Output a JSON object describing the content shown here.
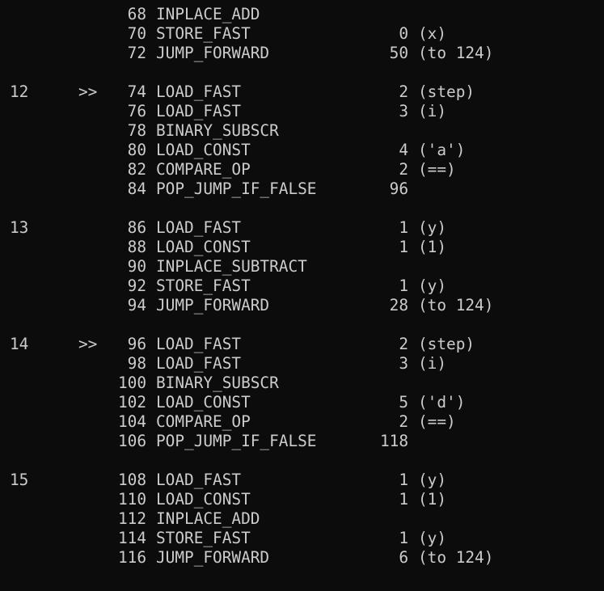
{
  "terminal": {
    "background": "#0c0c0c",
    "foreground": "#cccccc",
    "lines": [
      {
        "lineno": "",
        "jump": "",
        "offset": "68",
        "opname": "INPLACE_ADD",
        "arg": "",
        "argrepr": ""
      },
      {
        "lineno": "",
        "jump": "",
        "offset": "70",
        "opname": "STORE_FAST",
        "arg": "0",
        "argrepr": "(x)"
      },
      {
        "lineno": "",
        "jump": "",
        "offset": "72",
        "opname": "JUMP_FORWARD",
        "arg": "50",
        "argrepr": "(to 124)"
      },
      {
        "blank": true
      },
      {
        "lineno": "12",
        "jump": ">>",
        "offset": "74",
        "opname": "LOAD_FAST",
        "arg": "2",
        "argrepr": "(step)"
      },
      {
        "lineno": "",
        "jump": "",
        "offset": "76",
        "opname": "LOAD_FAST",
        "arg": "3",
        "argrepr": "(i)"
      },
      {
        "lineno": "",
        "jump": "",
        "offset": "78",
        "opname": "BINARY_SUBSCR",
        "arg": "",
        "argrepr": ""
      },
      {
        "lineno": "",
        "jump": "",
        "offset": "80",
        "opname": "LOAD_CONST",
        "arg": "4",
        "argrepr": "('a')"
      },
      {
        "lineno": "",
        "jump": "",
        "offset": "82",
        "opname": "COMPARE_OP",
        "arg": "2",
        "argrepr": "(==)"
      },
      {
        "lineno": "",
        "jump": "",
        "offset": "84",
        "opname": "POP_JUMP_IF_FALSE",
        "arg": "96",
        "argrepr": ""
      },
      {
        "blank": true
      },
      {
        "lineno": "13",
        "jump": "",
        "offset": "86",
        "opname": "LOAD_FAST",
        "arg": "1",
        "argrepr": "(y)"
      },
      {
        "lineno": "",
        "jump": "",
        "offset": "88",
        "opname": "LOAD_CONST",
        "arg": "1",
        "argrepr": "(1)"
      },
      {
        "lineno": "",
        "jump": "",
        "offset": "90",
        "opname": "INPLACE_SUBTRACT",
        "arg": "",
        "argrepr": ""
      },
      {
        "lineno": "",
        "jump": "",
        "offset": "92",
        "opname": "STORE_FAST",
        "arg": "1",
        "argrepr": "(y)"
      },
      {
        "lineno": "",
        "jump": "",
        "offset": "94",
        "opname": "JUMP_FORWARD",
        "arg": "28",
        "argrepr": "(to 124)"
      },
      {
        "blank": true
      },
      {
        "lineno": "14",
        "jump": ">>",
        "offset": "96",
        "opname": "LOAD_FAST",
        "arg": "2",
        "argrepr": "(step)"
      },
      {
        "lineno": "",
        "jump": "",
        "offset": "98",
        "opname": "LOAD_FAST",
        "arg": "3",
        "argrepr": "(i)"
      },
      {
        "lineno": "",
        "jump": "",
        "offset": "100",
        "opname": "BINARY_SUBSCR",
        "arg": "",
        "argrepr": ""
      },
      {
        "lineno": "",
        "jump": "",
        "offset": "102",
        "opname": "LOAD_CONST",
        "arg": "5",
        "argrepr": "('d')"
      },
      {
        "lineno": "",
        "jump": "",
        "offset": "104",
        "opname": "COMPARE_OP",
        "arg": "2",
        "argrepr": "(==)"
      },
      {
        "lineno": "",
        "jump": "",
        "offset": "106",
        "opname": "POP_JUMP_IF_FALSE",
        "arg": "118",
        "argrepr": ""
      },
      {
        "blank": true
      },
      {
        "lineno": "15",
        "jump": "",
        "offset": "108",
        "opname": "LOAD_FAST",
        "arg": "1",
        "argrepr": "(y)"
      },
      {
        "lineno": "",
        "jump": "",
        "offset": "110",
        "opname": "LOAD_CONST",
        "arg": "1",
        "argrepr": "(1)"
      },
      {
        "lineno": "",
        "jump": "",
        "offset": "112",
        "opname": "INPLACE_ADD",
        "arg": "",
        "argrepr": ""
      },
      {
        "lineno": "",
        "jump": "",
        "offset": "114",
        "opname": "STORE_FAST",
        "arg": "1",
        "argrepr": "(y)"
      },
      {
        "lineno": "",
        "jump": "",
        "offset": "116",
        "opname": "JUMP_FORWARD",
        "arg": "6",
        "argrepr": "(to 124)"
      }
    ]
  }
}
